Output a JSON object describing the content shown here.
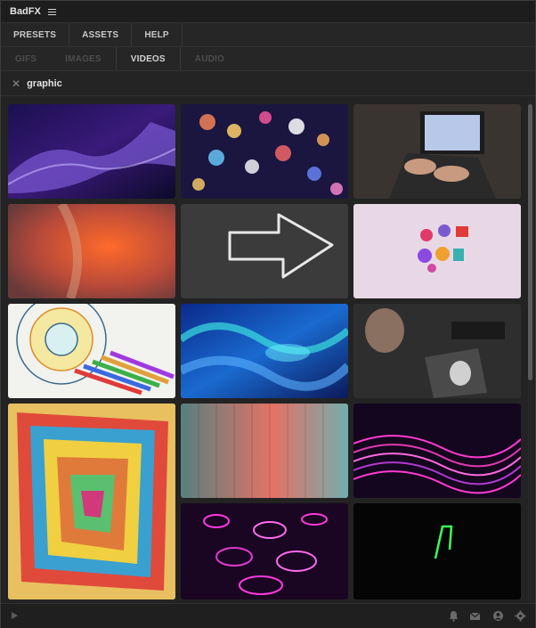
{
  "app": {
    "title": "BadFX"
  },
  "tabs": [
    {
      "label": "PRESETS"
    },
    {
      "label": "ASSETS"
    },
    {
      "label": "HELP"
    }
  ],
  "subtabs": [
    {
      "label": "GIFS",
      "active": false
    },
    {
      "label": "IMAGES",
      "active": false
    },
    {
      "label": "VIDEOS",
      "active": true
    },
    {
      "label": "AUDIO",
      "active": false
    }
  ],
  "search": {
    "query": "graphic"
  },
  "thumbnails": [
    {
      "subject": "purple particle wave"
    },
    {
      "subject": "colorful bokeh lights"
    },
    {
      "subject": "hands typing on laptop"
    },
    {
      "subject": "orange abstract macro"
    },
    {
      "subject": "chalk arrow on blackboard"
    },
    {
      "subject": "3d colorful shapes on pink"
    },
    {
      "subject": "coloring mandala with pencils"
    },
    {
      "subject": "blue liquid metal"
    },
    {
      "subject": "person drawing on tablet"
    },
    {
      "subject": "colorful spiral paper"
    },
    {
      "subject": "teal red gradient stripes"
    },
    {
      "subject": "neon pink landscape"
    },
    {
      "subject": "pink neon shapes"
    },
    {
      "subject": "green neon line on black"
    }
  ],
  "footer": {
    "icons": [
      "play-icon",
      "bell-icon",
      "mail-icon",
      "user-icon",
      "settings-icon"
    ]
  },
  "colors": {
    "background": "#232323",
    "titlebar": "#1d1d1d",
    "text": "#cfcfcf",
    "inactive_text": "#4d4d4d"
  }
}
